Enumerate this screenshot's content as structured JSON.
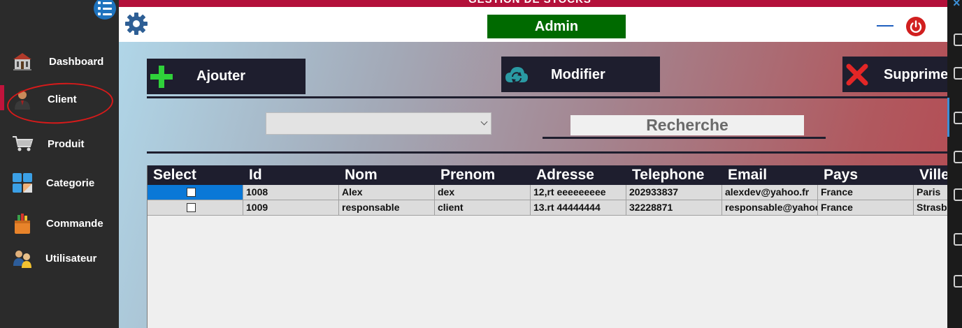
{
  "app": {
    "title": "GESTION DE STOCKS"
  },
  "sidebar": {
    "menu_icon": "list-icon",
    "items": [
      {
        "label": "Dashboard",
        "icon": "building-icon"
      },
      {
        "label": "Client",
        "icon": "person-icon"
      },
      {
        "label": "Produit",
        "icon": "cart-icon"
      },
      {
        "label": "Categorie",
        "icon": "tiles-icon"
      },
      {
        "label": "Commande",
        "icon": "shopping-bag-icon"
      },
      {
        "label": "Utilisateur",
        "icon": "users-icon"
      }
    ],
    "active": "Client",
    "active_color": "#c0143c"
  },
  "header": {
    "settings_icon": "gear-icon",
    "user_label": "Admin",
    "user_badge_color": "#006a00",
    "minimize_icon": "minimize-icon",
    "power_icon": "power-icon"
  },
  "toolbar": {
    "add_label": "Ajouter",
    "edit_label": "Modifier",
    "delete_label": "Supprimer"
  },
  "filters": {
    "combo_value": "",
    "search_placeholder": "Recherche"
  },
  "grid": {
    "columns": [
      "Select",
      "Id",
      "Nom",
      "Prenom",
      "Adresse",
      "Telephone",
      "Email",
      "Pays",
      "Ville"
    ],
    "rows": [
      {
        "selected": false,
        "highlighted": true,
        "id": "1008",
        "nom": "Alex",
        "prenom": "dex",
        "adresse": "12,rt eeeeeeeee",
        "telephone": "202933837",
        "email": "alexdev@yahoo.fr",
        "pays": "France",
        "ville": "Paris"
      },
      {
        "selected": false,
        "highlighted": false,
        "id": "1009",
        "nom": "responsable",
        "prenom": "client",
        "adresse": "13.rt 44444444",
        "telephone": "32228871",
        "email": "responsable@yahoo.fr",
        "pays": "France",
        "ville": "Strasbourg"
      }
    ]
  }
}
